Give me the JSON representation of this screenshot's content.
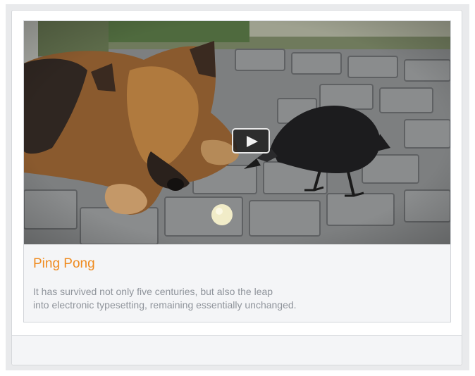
{
  "card": {
    "title": "Ping Pong",
    "description": "It has survived not only five centuries, but also the leap\n into electronic typesetting, remaining essentially unchanged.",
    "accent_color": "#ef8b1f",
    "text_color": "#8f949b"
  },
  "media": {
    "play_icon": "play-icon"
  }
}
